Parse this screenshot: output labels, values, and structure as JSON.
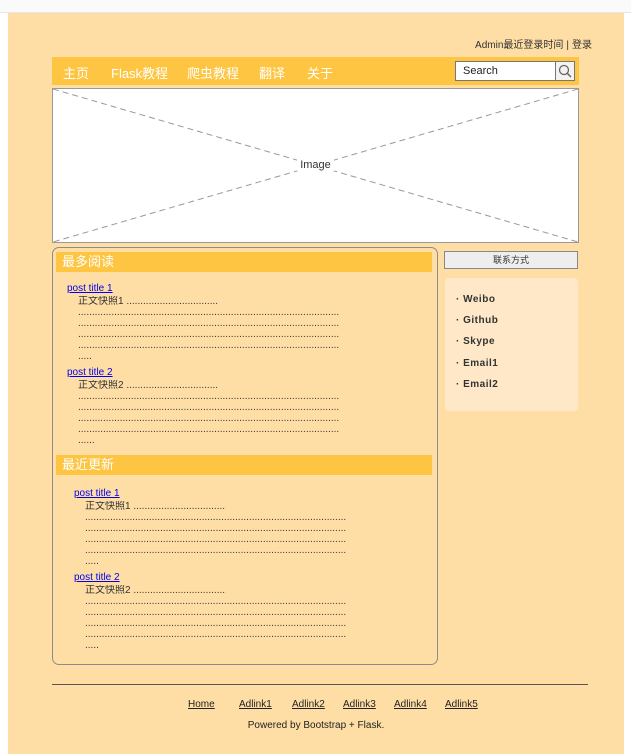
{
  "header": {
    "admin_text": "Admin最近登录时间",
    "separator": "|",
    "login_link": "登录"
  },
  "nav": {
    "items": [
      {
        "label": "主页"
      },
      {
        "label": "Flask教程"
      },
      {
        "label": "爬虫教程"
      },
      {
        "label": "翻译"
      },
      {
        "label": "关于"
      }
    ],
    "search_placeholder": "Search"
  },
  "banner": {
    "label": "Image"
  },
  "most_read": {
    "title": "最多阅读",
    "posts": [
      {
        "title": "post title 1",
        "summary": "正文快照1 .................................\n..............................................................................................\n..............................................................................................\n..............................................................................................\n..............................................................................................\n....."
      },
      {
        "title": "post title 2",
        "summary": "正文快照2 .................................\n..............................................................................................\n..............................................................................................\n..............................................................................................\n..............................................................................................\n......"
      }
    ]
  },
  "recent": {
    "title": "最近更新",
    "posts": [
      {
        "title": "post title 1",
        "summary": "正文快照1 .................................\n..............................................................................................\n..............................................................................................\n..............................................................................................\n..............................................................................................\n....."
      },
      {
        "title": "post title 2",
        "summary": "正文快照2 .................................\n..............................................................................................\n..............................................................................................\n..............................................................................................\n..............................................................................................\n....."
      }
    ]
  },
  "sidebar": {
    "contact_button": "联系方式",
    "contacts": [
      {
        "label": "· Weibo"
      },
      {
        "label": "· Github"
      },
      {
        "label": "· Skype"
      },
      {
        "label": "· Email1"
      },
      {
        "label": "· Email2"
      }
    ]
  },
  "footer": {
    "links": [
      {
        "label": "Home"
      },
      {
        "label": "Adlink1"
      },
      {
        "label": "Adlink2"
      },
      {
        "label": "Adlink3"
      },
      {
        "label": "Adlink4"
      },
      {
        "label": "Adlink5"
      }
    ],
    "powered": "Powered by Bootstrap + Flask."
  },
  "colors": {
    "page_bg": "#ffdea6",
    "nav_bg": "#fdc541",
    "link": "#0000ee",
    "panel_bg": "#ffe8c8"
  }
}
